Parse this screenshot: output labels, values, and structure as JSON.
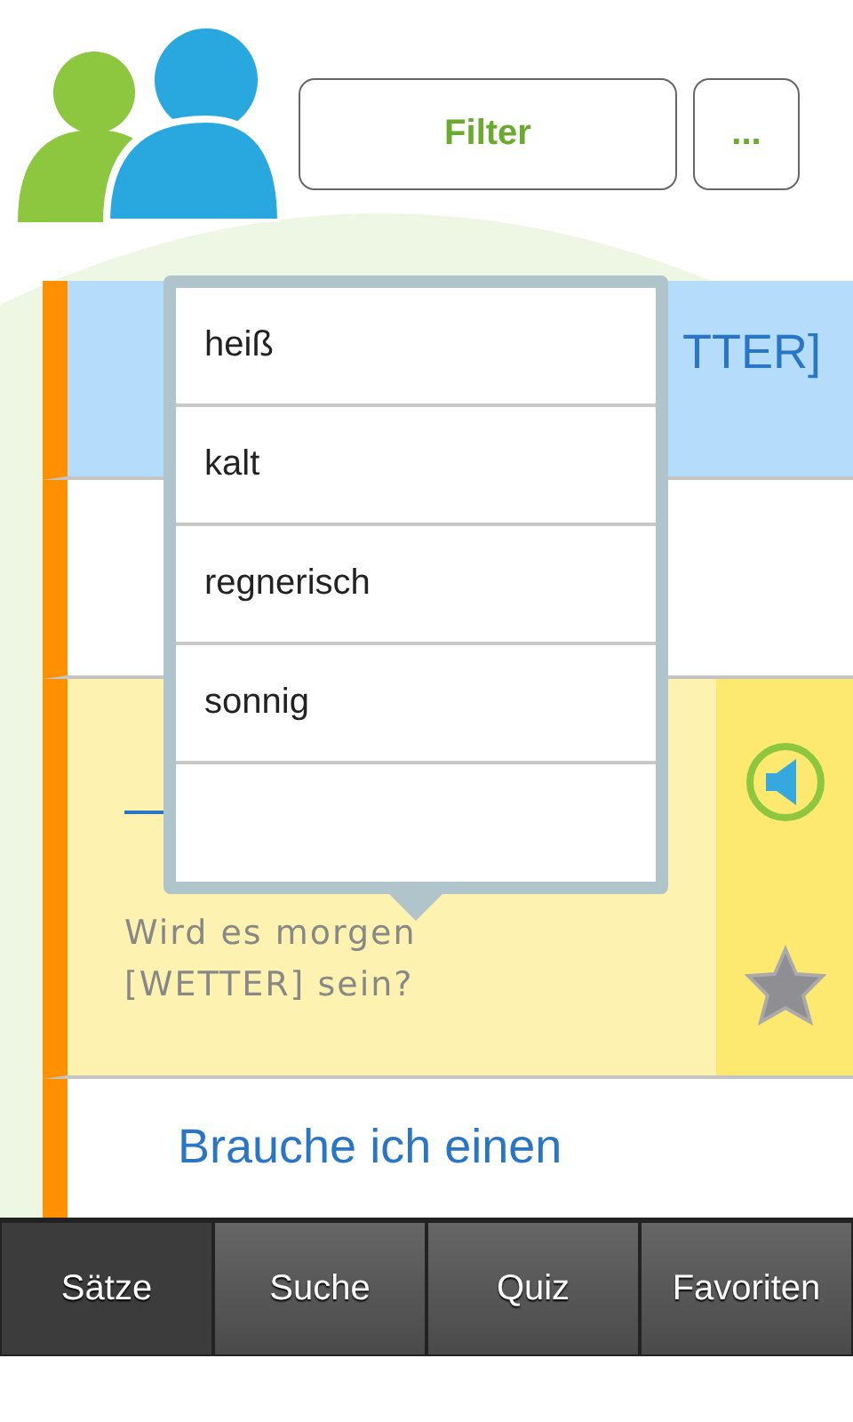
{
  "header": {
    "filter_button": "Filter",
    "more_button": "..."
  },
  "rows": [
    {
      "text": "TTER]",
      "selected": true,
      "expanded": false
    },
    {
      "selected": false,
      "expanded": false
    },
    {
      "text": "Wird es morgen [WETTER] sein?",
      "selected": false,
      "expanded": true
    },
    {
      "text": "Brauche ich einen",
      "selected": false,
      "expanded": false
    }
  ],
  "dropdown": {
    "options": [
      "heiß",
      "kalt",
      "regnerisch",
      "sonnig"
    ]
  },
  "tabs": [
    {
      "label": "Sätze",
      "selected": true
    },
    {
      "label": "Suche",
      "selected": false
    },
    {
      "label": "Quiz",
      "selected": false
    },
    {
      "label": "Favoriten",
      "selected": false
    }
  ]
}
